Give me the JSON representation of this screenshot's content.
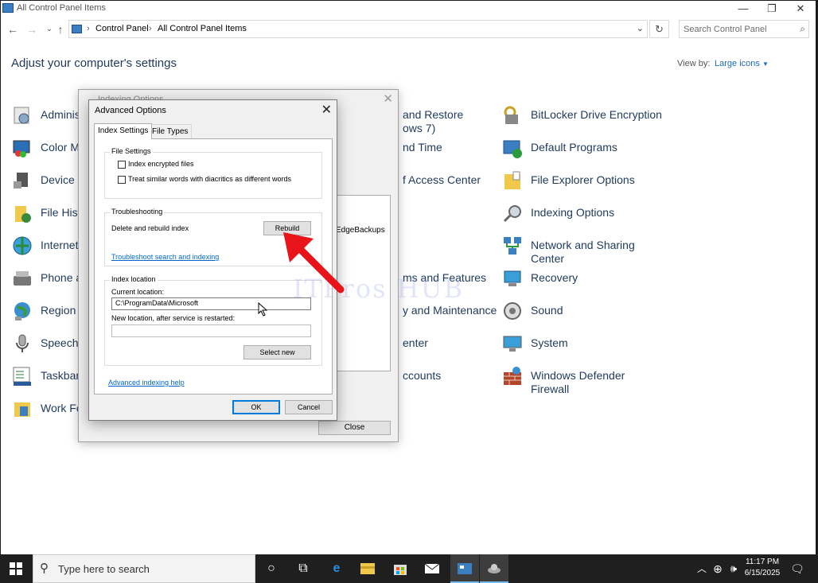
{
  "window": {
    "title": "All Control Panel Items"
  },
  "address": {
    "crumbs": [
      "Control Panel",
      "All Control Panel Items"
    ],
    "search_placeholder": "Search Control Panel"
  },
  "heading": "Adjust your computer's settings",
  "view_by": {
    "label": "View by:",
    "value": "Large icons"
  },
  "items_col1": [
    {
      "label": "Adminis",
      "icon": "admin-tools-icon"
    },
    {
      "label": "Color Ma",
      "icon": "color-management-icon"
    },
    {
      "label": "Device M",
      "icon": "device-manager-icon"
    },
    {
      "label": "File Histo",
      "icon": "file-history-icon"
    },
    {
      "label": "Internet",
      "icon": "internet-options-icon"
    },
    {
      "label": "Phone a",
      "icon": "phone-modem-icon"
    },
    {
      "label": "Region",
      "icon": "region-icon"
    },
    {
      "label": "Speech R",
      "icon": "speech-recognition-icon"
    },
    {
      "label": "Taskbar a",
      "icon": "taskbar-icon"
    },
    {
      "label": "Work Fo",
      "icon": "work-folders-icon"
    }
  ],
  "items_col2": [
    {
      "label": "and Restore",
      "label2": "ows 7)"
    },
    {
      "label": "nd Time"
    },
    {
      "label": "f Access Center"
    },
    {
      "label": "ms and Features"
    },
    {
      "label": "y and Maintenance"
    },
    {
      "label": "enter"
    },
    {
      "label": "ccounts"
    }
  ],
  "items_col3": [
    {
      "label": "BitLocker Drive Encryption",
      "icon": "bitlocker-icon"
    },
    {
      "label": "Default Programs",
      "icon": "default-programs-icon"
    },
    {
      "label": "File Explorer Options",
      "icon": "folder-options-icon"
    },
    {
      "label": "Indexing Options",
      "icon": "indexing-options-icon"
    },
    {
      "label": "Network and Sharing",
      "label2": "Center",
      "icon": "network-icon"
    },
    {
      "label": "Recovery",
      "icon": "recovery-icon"
    },
    {
      "label": "Sound",
      "icon": "sound-icon"
    },
    {
      "label": "System",
      "icon": "system-icon"
    },
    {
      "label": "Windows Defender",
      "label2": "Firewall",
      "icon": "firewall-icon"
    }
  ],
  "indexing_window": {
    "title": "Indexing Options",
    "list_item": "EdgeBackups",
    "close_label": "Close"
  },
  "advanced": {
    "title": "Advanced Options",
    "tabs": [
      "Index Settings",
      "File Types"
    ],
    "file_settings": {
      "title": "File Settings",
      "encrypt": "Index encrypted files",
      "diacritics": "Treat similar words with diacritics as different words"
    },
    "troubleshooting": {
      "title": "Troubleshooting",
      "delete_label": "Delete and rebuild index",
      "rebuild_label": "Rebuild",
      "link": "Troubleshoot search and indexing"
    },
    "index_location": {
      "title": "Index location",
      "current_label": "Current location:",
      "current_value": "C:\\ProgramData\\Microsoft",
      "new_label": "New location, after service is restarted:",
      "new_value": "",
      "select_label": "Select new"
    },
    "help_link": "Advanced indexing help",
    "ok_label": "OK",
    "cancel_label": "Cancel"
  },
  "watermark": "ITPros HUB",
  "taskbar": {
    "search_placeholder": "Type here to search",
    "time": "11:17 PM",
    "date": "6/15/2025"
  },
  "colors": {
    "link": "#1e395b",
    "accent": "#0078d7",
    "arrow": "#e8141a"
  }
}
